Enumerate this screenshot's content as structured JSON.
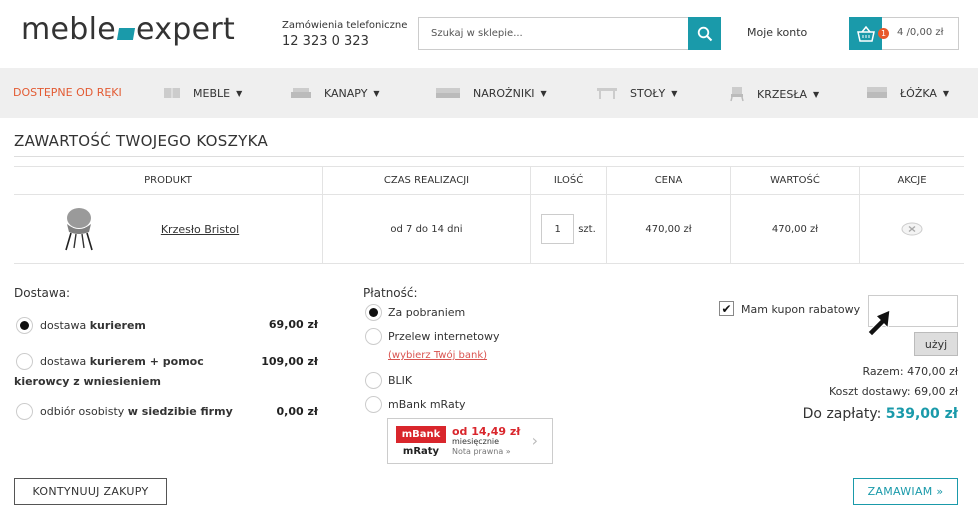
{
  "header": {
    "logo_left": "meble",
    "logo_right": "expert",
    "phone_label": "Zamówienia telefoniczne",
    "phone_number": "12 323 0 323",
    "search_placeholder": "Szukaj w sklepie...",
    "account_label": "Moje konto",
    "cart_badge": "1",
    "cart_summary": "4 /0,00 zł"
  },
  "nav": {
    "items": [
      {
        "label": "DOSTĘPNE OD RĘKI",
        "icon": "none"
      },
      {
        "label": "MEBLE",
        "icon": "sideboard-icon"
      },
      {
        "label": "KANAPY",
        "icon": "sofa-icon"
      },
      {
        "label": "NAROŻNIKI",
        "icon": "corner-sofa-icon"
      },
      {
        "label": "STOŁY",
        "icon": "table-icon"
      },
      {
        "label": "KRZESŁA",
        "icon": "chair-icon"
      },
      {
        "label": "ŁÓŻKA",
        "icon": "bed-icon"
      }
    ],
    "caret": "▼"
  },
  "page_title": "ZAWARTOŚĆ TWOJEGO KOSZYKA",
  "cart_table": {
    "headers": [
      "PRODUKT",
      "CZAS REALIZACJI",
      "ILOŚĆ",
      "CENA",
      "WARTOŚĆ",
      "AKCJE"
    ],
    "rows": [
      {
        "product": "Krzesło Bristol",
        "lead_time": "od 7 do 14 dni",
        "quantity": "1",
        "unit": "szt.",
        "price": "470,00 zł",
        "value": "470,00 zł"
      }
    ]
  },
  "delivery": {
    "label": "Dostawa:",
    "options": [
      {
        "text_a": "dostawa ",
        "text_b": "kurierem",
        "price": "69,00 zł",
        "selected": true
      },
      {
        "text_a": "dostawa ",
        "text_b": "kurierem + pomoc",
        "text_c": "kierowcy z wniesieniem",
        "price": "109,00 zł",
        "selected": false
      },
      {
        "text_a": "odbiór osobisty ",
        "text_b": "w siedzibie firmy",
        "price": "0,00 zł",
        "selected": false
      }
    ]
  },
  "payment": {
    "label": "Płatność:",
    "options": [
      {
        "text": "Za pobraniem",
        "selected": true
      },
      {
        "text": "Przelew internetowy",
        "selected": false
      },
      {
        "text": "BLIK",
        "selected": false
      },
      {
        "text": "mBank mRaty",
        "selected": false
      }
    ],
    "bank_link": "(wybierz Twój bank)",
    "mbank": {
      "logo_top": "mBank",
      "logo_bottom": "mRaty",
      "amount": "od 14,49 zł",
      "monthly": "miesięcznie",
      "note": "Nota prawna »"
    }
  },
  "coupon": {
    "label": "Mam kupon rabatowy",
    "checked": "✔",
    "use_button": "użyj"
  },
  "summary": {
    "subtotal": "Razem: 470,00 zł",
    "shipping": "Koszt dostawy: 69,00 zł",
    "total_label": "Do zapłaty: ",
    "total_value": "539,00 zł"
  },
  "actions": {
    "continue": "KONTYNUUJ ZAKUPY",
    "order": "ZAMAWIAM »"
  },
  "colors": {
    "accent": "#1a9aaa",
    "highlight": "#e35b33",
    "mbank_red": "#d9262c"
  }
}
